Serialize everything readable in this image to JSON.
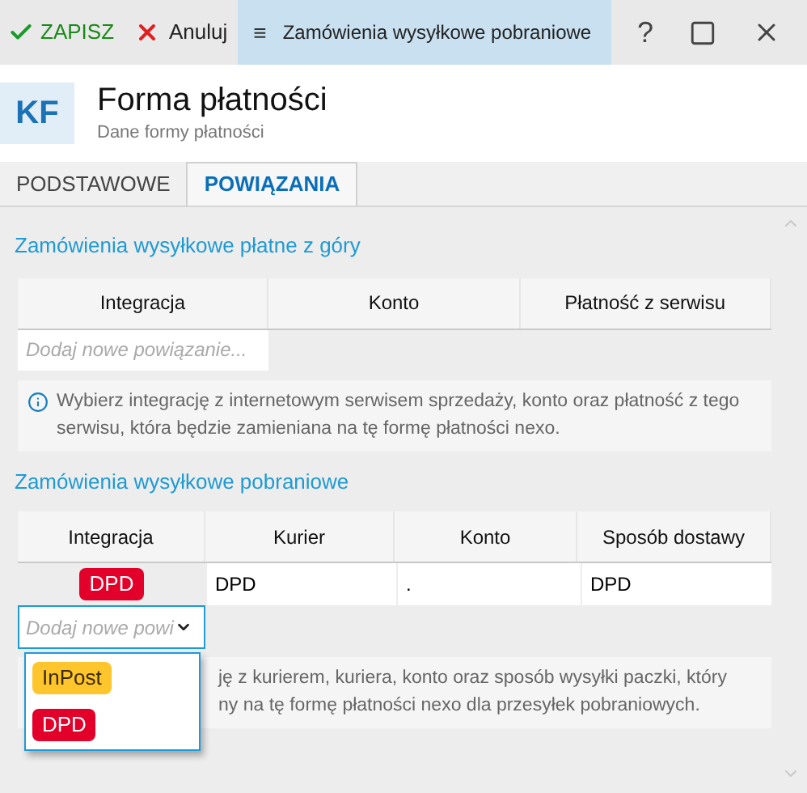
{
  "toolbar": {
    "save": "ZAPISZ",
    "cancel": "Anuluj",
    "menu_glyph": "≡",
    "title": "Zamówienia wysyłkowe pobraniowe",
    "help": "?"
  },
  "header": {
    "initials": "KF",
    "title": "Forma płatności",
    "subtitle": "Dane formy płatności"
  },
  "tabs": [
    {
      "label": "PODSTAWOWE",
      "selected": false
    },
    {
      "label": "POWIĄZANIA",
      "selected": true
    }
  ],
  "prepaid": {
    "title": "Zamówienia wysyłkowe płatne z góry",
    "columns": [
      "Integracja",
      "Konto",
      "Płatność z serwisu"
    ],
    "add_placeholder": "Dodaj nowe powiązanie...",
    "info": "Wybierz integrację z internetowym serwisem sprzedaży, konto oraz płatność z tego serwisu, która będzie zamieniana na tę formę płatności nexo."
  },
  "cod": {
    "title": "Zamówienia wysyłkowe pobraniowe",
    "columns": [
      "Integracja",
      "Kurier",
      "Konto",
      "Sposób dostawy"
    ],
    "rows": [
      {
        "integration": {
          "label": "DPD",
          "color": "#e2002a"
        },
        "courier": "DPD",
        "account": ".",
        "delivery": "DPD"
      }
    ],
    "add_placeholder": "Dodaj nowe powi",
    "dropdown_options": [
      {
        "label": "InPost",
        "color": "#ffc52c"
      },
      {
        "label": "DPD",
        "color": "#e2002a"
      }
    ],
    "info_lines": [
      "ję z kurierem, kuriera, konto oraz sposób wysyłki paczki, który",
      "ny na tę formę płatności nexo dla przesyłek pobraniowych."
    ]
  }
}
